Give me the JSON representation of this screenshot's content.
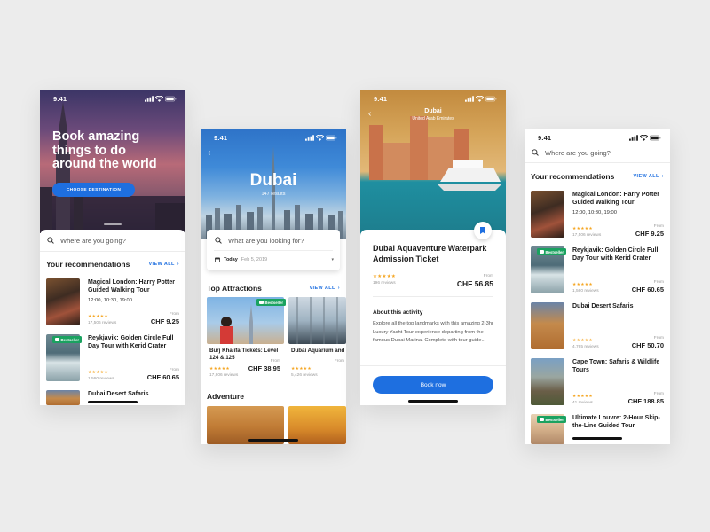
{
  "colors": {
    "accent": "#1e6fe0",
    "badge": "#1aa260",
    "stars": "#f5a623",
    "background": "#ececec"
  },
  "screen1": {
    "time": "9:41",
    "headline": "Book amazing things to do around the world",
    "cta": "CHOOSE DESTINATION",
    "search_placeholder": "Where are you going?",
    "section_title": "Your recommendations",
    "view_all": "VIEW ALL",
    "recs": [
      {
        "title": "Magical London: Harry Potter Guided Walking Tour",
        "times": "12:00, 10:30, 19:00",
        "stars": "★★★★★",
        "reviews": "17,506 reviews",
        "from": "From",
        "price": "CHF 9.25"
      },
      {
        "title": "Reykjavik: Golden Circle Full Day Tour with Kerid Crater",
        "badge": "Bestseller",
        "stars": "★★★★★",
        "reviews": "1,560 reviews",
        "from": "From",
        "price": "CHF 60.65"
      },
      {
        "title": "Dubai Desert Safaris"
      }
    ]
  },
  "screen2": {
    "time": "9:41",
    "city": "Dubai",
    "results": "147 results",
    "search_placeholder": "What are you looking for?",
    "date_today": "Today",
    "date_value": "Feb 5, 2019",
    "section_title": "Top Attractions",
    "view_all": "VIEW ALL",
    "cards": [
      {
        "title": "Burj Khalifa Tickets: Level 124 & 125",
        "badge": "Bestseller",
        "stars": "★★★★★",
        "reviews": "17,806 reviews",
        "from": "From",
        "price": "CHF 38.95"
      },
      {
        "title": "Dubai Aquarium and Burj Khalifa Combo Ticket",
        "stars": "★★★★★",
        "reviews": "5,426 reviews",
        "from": "From"
      }
    ],
    "section2_title": "Adventure"
  },
  "screen3": {
    "time": "9:41",
    "city": "Dubai",
    "country": "United Arab Emirates",
    "title": "Dubai Aquaventure Waterpark Admission Ticket",
    "stars": "★★★★★",
    "reviews": "196 reviews",
    "from": "From",
    "price": "CHF 56.85",
    "about_title": "About this activity",
    "about_text": "Explore all the top landmarks with this amazing 2-3hr Luxury Yacht Tour experience departing from the famous Dubai Marina. Complete with tour guide...",
    "book_label": "Book now"
  },
  "screen4": {
    "time": "9:41",
    "search_placeholder": "Where are you going?",
    "section_title": "Your recommendations",
    "view_all": "VIEW ALL",
    "recs": [
      {
        "title": "Magical London: Harry Potter Guided Walking Tour",
        "times": "12:00, 10:30, 19:00",
        "stars": "★★★★★",
        "reviews": "17,506 reviews",
        "from": "From",
        "price": "CHF 9.25"
      },
      {
        "title": "Reykjavik: Golden Circle Full Day Tour with Kerid Crater",
        "badge": "Bestseller",
        "stars": "★★★★★",
        "reviews": "1,560 reviews",
        "from": "From",
        "price": "CHF 60.65"
      },
      {
        "title": "Dubai Desert Safaris",
        "stars": "★★★★★",
        "reviews": "4,765 reviews",
        "from": "From",
        "price": "CHF 50.70"
      },
      {
        "title": "Cape Town: Safaris & Wildlife Tours",
        "stars": "★★★★★",
        "reviews": "41 reviews",
        "from": "From",
        "price": "CHF 188.85"
      },
      {
        "title": "Ultimate Louvre: 2-Hour Skip-the-Line Guided Tour",
        "badge": "Bestseller"
      }
    ]
  }
}
